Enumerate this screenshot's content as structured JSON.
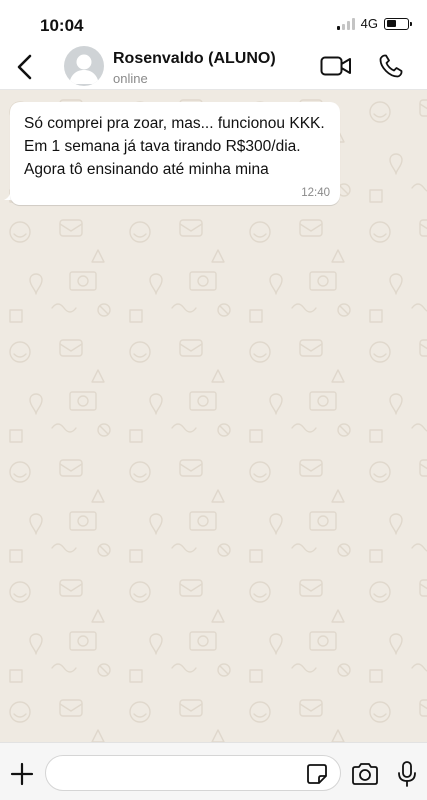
{
  "status_bar": {
    "time": "10:04",
    "network": "4G",
    "signal_bars_active": 1,
    "signal_bars_total": 4,
    "battery_level": 0.45
  },
  "header": {
    "contact_name": "Rosenvaldo (ALUNO)",
    "contact_status": "online",
    "icons": {
      "back": "chevron-left-icon",
      "avatar": "default-avatar",
      "video": "video-call-icon",
      "phone": "phone-icon"
    }
  },
  "chat": {
    "background_color": "#efeae2",
    "messages": [
      {
        "direction": "incoming",
        "text": "Só comprei pra zoar, mas... funcionou KKK. Em 1 semana já tava tirando R$300/dia. Agora tô ensinando até minha mina",
        "time": "12:40"
      }
    ]
  },
  "input_bar": {
    "value": "",
    "placeholder": "",
    "icons": {
      "attach": "plus-icon",
      "sticker": "sticker-icon",
      "camera": "camera-icon",
      "mic": "microphone-icon"
    }
  },
  "colors": {
    "accent": "#111111",
    "bubble": "#ffffff",
    "muted_text": "#8a8a8a"
  }
}
